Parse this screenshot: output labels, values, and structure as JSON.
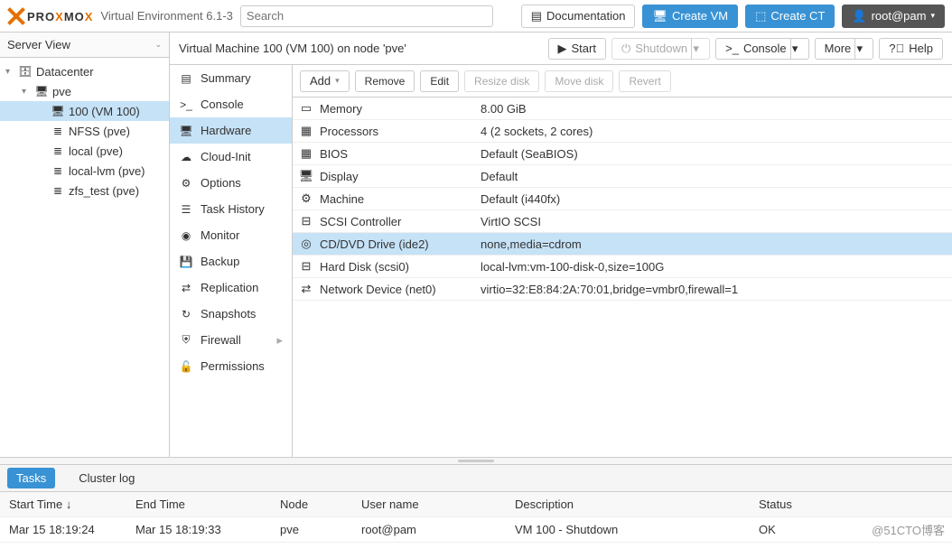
{
  "header": {
    "brand_pro": "PRO",
    "brand_mo": "MO",
    "ver": "Virtual Environment 6.1-3",
    "search_placeholder": "Search",
    "doc": "Documentation",
    "create_vm": "Create VM",
    "create_ct": "Create CT",
    "user": "root@pam"
  },
  "tree": {
    "view_label": "Server View",
    "items": [
      {
        "label": "Datacenter",
        "icon": "server",
        "indent": 0,
        "caret": true
      },
      {
        "label": "pve",
        "icon": "node",
        "indent": 1,
        "caret": true
      },
      {
        "label": "100 (VM 100)",
        "icon": "vm",
        "indent": 2,
        "selected": true
      },
      {
        "label": "NFSS (pve)",
        "icon": "storage",
        "indent": 2
      },
      {
        "label": "local (pve)",
        "icon": "storage",
        "indent": 2
      },
      {
        "label": "local-lvm (pve)",
        "icon": "storage",
        "indent": 2
      },
      {
        "label": "zfs_test (pve)",
        "icon": "storage",
        "indent": 2
      }
    ]
  },
  "crumb": {
    "title": "Virtual Machine 100 (VM 100) on node 'pve'",
    "start": "Start",
    "shutdown": "Shutdown",
    "console": "Console",
    "more": "More",
    "help": "Help"
  },
  "menu": [
    {
      "label": "Summary",
      "icon": "book"
    },
    {
      "label": "Console",
      "icon": "terminal"
    },
    {
      "label": "Hardware",
      "icon": "desktop",
      "selected": true
    },
    {
      "label": "Cloud-Init",
      "icon": "cloud"
    },
    {
      "label": "Options",
      "icon": "gear"
    },
    {
      "label": "Task History",
      "icon": "list"
    },
    {
      "label": "Monitor",
      "icon": "eye"
    },
    {
      "label": "Backup",
      "icon": "save"
    },
    {
      "label": "Replication",
      "icon": "sync"
    },
    {
      "label": "Snapshots",
      "icon": "history"
    },
    {
      "label": "Firewall",
      "icon": "shield",
      "expand": true
    },
    {
      "label": "Permissions",
      "icon": "unlock"
    }
  ],
  "toolbar": {
    "add": "Add",
    "remove": "Remove",
    "edit": "Edit",
    "resize": "Resize disk",
    "move": "Move disk",
    "revert": "Revert"
  },
  "hardware": [
    {
      "icon": "memory",
      "k": "Memory",
      "v": "8.00 GiB"
    },
    {
      "icon": "cpu",
      "k": "Processors",
      "v": "4 (2 sockets, 2 cores)"
    },
    {
      "icon": "chip",
      "k": "BIOS",
      "v": "Default (SeaBIOS)"
    },
    {
      "icon": "desktop",
      "k": "Display",
      "v": "Default"
    },
    {
      "icon": "gear",
      "k": "Machine",
      "v": "Default (i440fx)"
    },
    {
      "icon": "hdd",
      "k": "SCSI Controller",
      "v": "VirtIO SCSI"
    },
    {
      "icon": "disc",
      "k": "CD/DVD Drive (ide2)",
      "v": "none,media=cdrom",
      "selected": true
    },
    {
      "icon": "hdd",
      "k": "Hard Disk (scsi0)",
      "v": "local-lvm:vm-100-disk-0,size=100G"
    },
    {
      "icon": "swap",
      "k": "Network Device (net0)",
      "v": "virtio=32:E8:84:2A:70:01,bridge=vmbr0,firewall=1"
    }
  ],
  "bottom": {
    "tab_tasks": "Tasks",
    "tab_cluster": "Cluster log",
    "cols": [
      "Start Time ↓",
      "End Time",
      "Node",
      "User name",
      "Description",
      "Status"
    ],
    "row": [
      "Mar 15 18:19:24",
      "Mar 15 18:19:33",
      "pve",
      "root@pam",
      "VM 100 - Shutdown",
      "OK"
    ]
  },
  "watermark": "@51CTO博客"
}
